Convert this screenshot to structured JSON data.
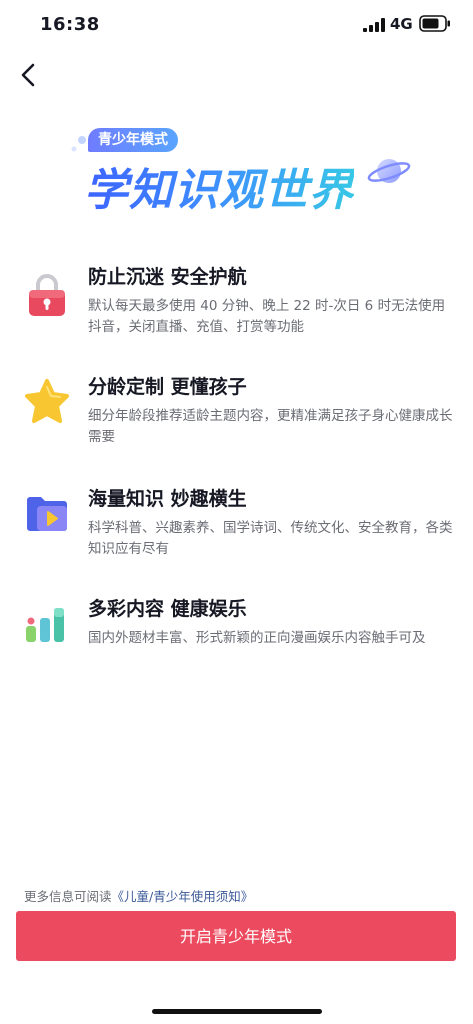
{
  "status_bar": {
    "time": "16:38",
    "network": "4G",
    "signal_icon": "signal-bars-icon",
    "battery_icon": "battery-icon"
  },
  "nav": {
    "back_icon": "back-arrow-icon"
  },
  "hero": {
    "badge": "青少年模式",
    "title": "学知识观世界",
    "decoration_icon": "planet-icon"
  },
  "features": [
    {
      "icon": "lock-icon",
      "title": "防止沉迷 安全护航",
      "desc": "默认每天最多使用 40 分钟、晚上 22 时-次日 6 时无法使用抖音，关闭直播、充值、打赏等功能"
    },
    {
      "icon": "star-icon",
      "title": "分龄定制 更懂孩子",
      "desc": "细分年龄段推荐适龄主题内容，更精准满足孩子身心健康成长需要"
    },
    {
      "icon": "video-folder-icon",
      "title": "海量知识 妙趣横生",
      "desc": "科学科普、兴趣素养、国学诗词、传统文化、安全教育，各类知识应有尽有"
    },
    {
      "icon": "bar-chart-icon",
      "title": "多彩内容 健康娱乐",
      "desc": "国内外题材丰富、形式新颖的正向漫画娱乐内容触手可及"
    }
  ],
  "footer": {
    "info_prefix": "更多信息可阅读",
    "info_link": "《儿童/青少年使用须知》",
    "button_label": "开启青少年模式"
  },
  "colors": {
    "accent": "#ec4a5e",
    "link": "#3c5a99",
    "title_gradient_start": "#3d63ff",
    "title_gradient_end": "#38c7e6"
  }
}
